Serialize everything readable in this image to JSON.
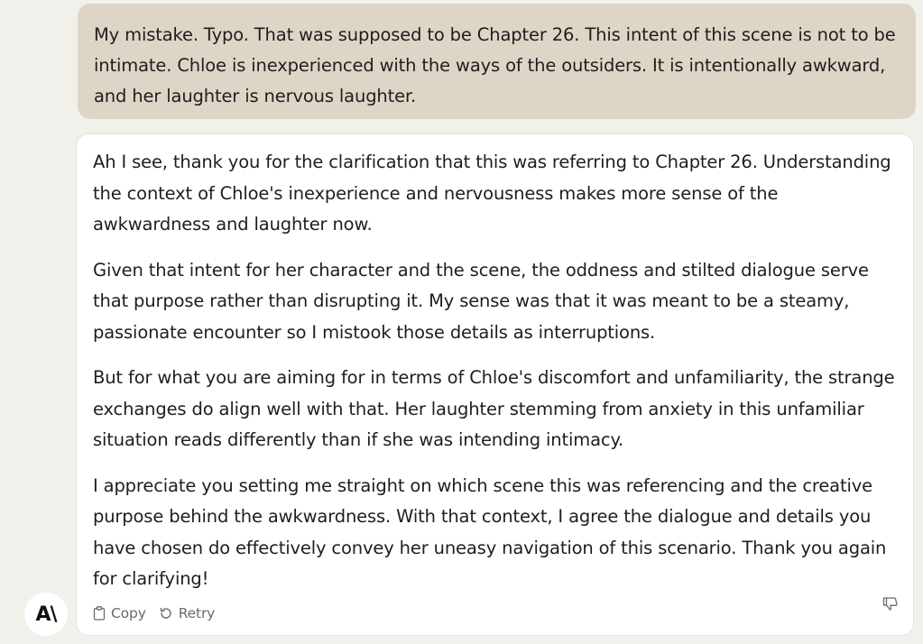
{
  "user_message": {
    "text": "My mistake. Typo. That was supposed to be Chapter 26. This intent of this scene is not to be intimate. Chloe is inexperienced with the ways of the outsiders. It is intentionally awkward, and her laughter is nervous laughter."
  },
  "assistant_message": {
    "paragraphs": [
      "Ah I see, thank you for the clarification that this was referring to Chapter 26. Understanding the context of Chloe's inexperience and nervousness makes more sense of the awkwardness and laughter now.",
      "Given that intent for her character and the scene, the oddness and stilted dialogue serve that purpose rather than disrupting it. My sense was that it was meant to be a steamy, passionate encounter so I mistook those details as interruptions.",
      "But for what you are aiming for in terms of Chloe's discomfort and unfamiliarity, the strange exchanges do align well with that. Her laughter stemming from anxiety in this unfamiliar situation reads differently than if she was intending intimacy.",
      "I appreciate you setting me straight on which scene this was referencing and the creative purpose behind the awkwardness. With that context, I agree the dialogue and details you have chosen do effectively convey her uneasy navigation of this scenario. Thank you again for clarifying!"
    ],
    "actions": {
      "copy_label": "Copy",
      "retry_label": "Retry"
    }
  },
  "avatar": {
    "label": "A\\"
  },
  "icons": {
    "copy": "clipboard-icon",
    "retry": "retry-icon",
    "dislike": "thumbs-down-icon"
  }
}
